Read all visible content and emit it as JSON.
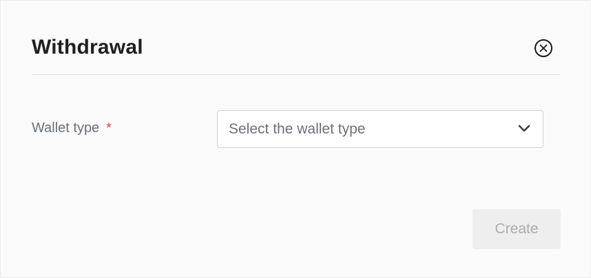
{
  "dialog": {
    "title": "Withdrawal",
    "close_icon": "close-circle-icon"
  },
  "form": {
    "wallet_type": {
      "label": "Wallet type",
      "required_marker": "*",
      "placeholder": "Select the wallet type",
      "dropdown_icon": "chevron-down-icon"
    }
  },
  "actions": {
    "create_label": "Create",
    "create_enabled": false
  },
  "colors": {
    "required": "#d4373b",
    "disabled_button_bg": "#eeeeee",
    "disabled_button_text": "#a9abae"
  }
}
